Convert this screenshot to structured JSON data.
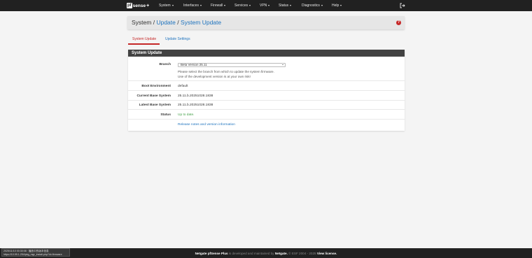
{
  "brand": {
    "logo": "pf",
    "name": "sense",
    "plus": "+"
  },
  "nav": [
    {
      "label": "System"
    },
    {
      "label": "Interfaces"
    },
    {
      "label": "Firewall"
    },
    {
      "label": "Services"
    },
    {
      "label": "VPN"
    },
    {
      "label": "Status"
    },
    {
      "label": "Diagnostics"
    },
    {
      "label": "Help"
    }
  ],
  "breadcrumb": {
    "root": "System",
    "sep1": "/",
    "level2": "Update",
    "sep2": "/",
    "level3": "System Update"
  },
  "help_icon": {
    "glyph": "?"
  },
  "tabs": {
    "system_update": "System Update",
    "update_settings": "Update Settings"
  },
  "panel": {
    "title": "System Update",
    "branch": {
      "label": "Branch",
      "selected": "Beta Version 25.11",
      "help_line1": "Please select the branch from which to update the system firmware.",
      "help_line2": "Use of the development version is at your own risk!"
    },
    "boot_env": {
      "label": "Boot Environment",
      "value": "default"
    },
    "current": {
      "label": "Current Base System",
      "value": "25.11.b.20251028.1838"
    },
    "latest": {
      "label": "Latest Base System",
      "value": "25.11.b.20251028.1838"
    },
    "status": {
      "label": "Status",
      "value": "Up to date."
    },
    "release_notes": "Release notes and version information"
  },
  "footer": {
    "product": "Netgate pfSense Plus",
    "mid": "is developed and maintained by",
    "company": "Netgate.",
    "copy": "© ESF 2004 - 2025",
    "license": "View license."
  },
  "tooltip": {
    "line1": "2025/11/10 00:30:08 · 播放中的版本信息",
    "line2": "https://10.99.1.254/pkg_mgr_install.php?id=firmware"
  },
  "colors": {
    "navbar": "#212121",
    "accent": "#c62828",
    "link": "#1e73be",
    "ok": "#43a047"
  },
  "icons": {
    "logout": "logout-icon",
    "help": "help-icon",
    "caret": "caret-down-icon"
  }
}
